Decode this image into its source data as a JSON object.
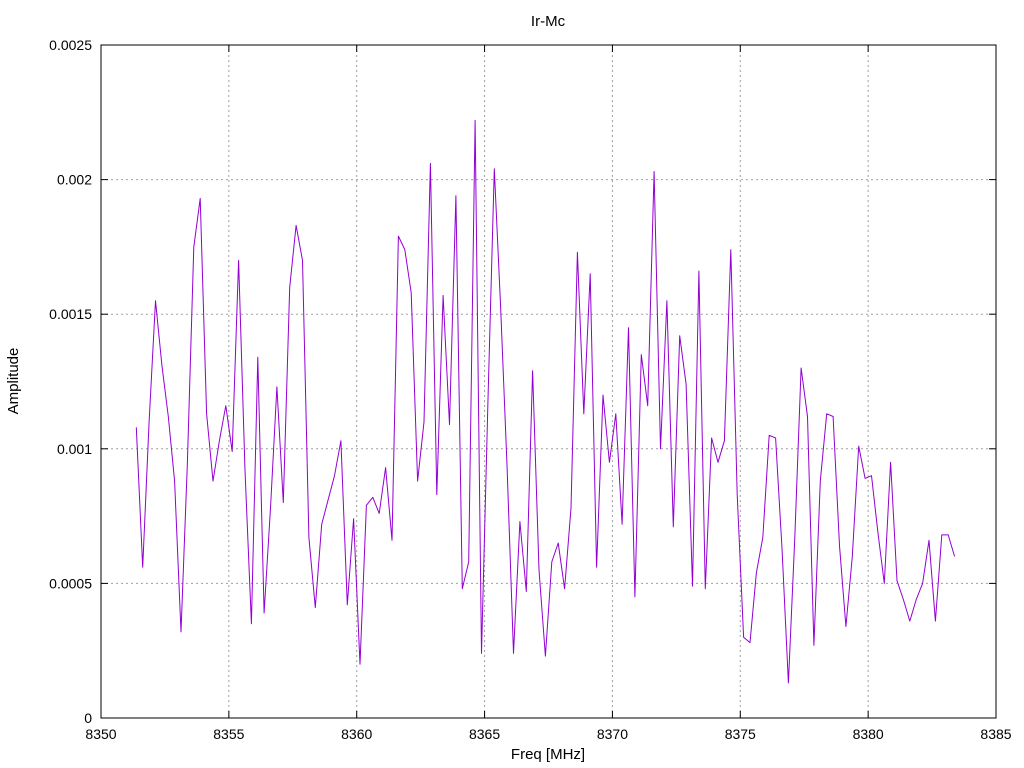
{
  "chart_data": {
    "type": "line",
    "title": "Ir-Mc",
    "xlabel": "Freq [MHz]",
    "ylabel": "Amplitude",
    "xlim": [
      8350,
      8385
    ],
    "ylim": [
      0,
      0.0025
    ],
    "x_ticks": [
      "8350",
      "8355",
      "8360",
      "8365",
      "8370",
      "8375",
      "8380",
      "8385"
    ],
    "y_ticks": [
      "0",
      "0.0005",
      "0.001",
      "0.0015",
      "0.002",
      "0.0025"
    ],
    "grid": true,
    "line_color": "#9400d3",
    "series": [
      {
        "x": [
          8351.38,
          8351.63,
          8351.88,
          8352.13,
          8352.38,
          8352.63,
          8352.88,
          8353.13,
          8353.38,
          8353.63,
          8353.88,
          8354.13,
          8354.38,
          8354.63,
          8354.88,
          8355.13,
          8355.38,
          8355.63,
          8355.88,
          8356.13,
          8356.38,
          8356.63,
          8356.88,
          8357.13,
          8357.38,
          8357.63,
          8357.88,
          8358.13,
          8358.38,
          8358.63,
          8358.88,
          8359.13,
          8359.38,
          8359.63,
          8359.88,
          8360.13,
          8360.38,
          8360.63,
          8360.88,
          8361.13,
          8361.38,
          8361.63,
          8361.88,
          8362.13,
          8362.38,
          8362.63,
          8362.88,
          8363.13,
          8363.38,
          8363.63,
          8363.88,
          8364.13,
          8364.38,
          8364.63,
          8364.88,
          8365.13,
          8365.38,
          8365.63,
          8365.88,
          8366.13,
          8366.38,
          8366.63,
          8366.88,
          8367.13,
          8367.38,
          8367.63,
          8367.88,
          8368.13,
          8368.38,
          8368.63,
          8368.88,
          8369.13,
          8369.38,
          8369.63,
          8369.88,
          8370.13,
          8370.38,
          8370.63,
          8370.88,
          8371.13,
          8371.38,
          8371.63,
          8371.88,
          8372.13,
          8372.38,
          8372.63,
          8372.88,
          8373.13,
          8373.38,
          8373.63,
          8373.88,
          8374.13,
          8374.38,
          8374.63,
          8374.88,
          8375.13,
          8375.38,
          8375.63,
          8375.88,
          8376.13,
          8376.38,
          8376.63,
          8376.88,
          8377.13,
          8377.38,
          8377.63,
          8377.88,
          8378.13,
          8378.38,
          8378.63,
          8378.88,
          8379.13,
          8379.38,
          8379.63,
          8379.88,
          8380.13,
          8380.38,
          8380.63,
          8380.88,
          8381.13,
          8381.38,
          8381.63,
          8381.88,
          8382.13,
          8382.38,
          8382.63,
          8382.88,
          8383.13,
          8383.38
        ],
        "y": [
          0.00108,
          0.00056,
          0.0011,
          0.00155,
          0.00131,
          0.00112,
          0.00088,
          0.00032,
          0.00095,
          0.00175,
          0.00193,
          0.00113,
          0.00088,
          0.00103,
          0.00116,
          0.00099,
          0.0017,
          0.00092,
          0.00035,
          0.00134,
          0.00039,
          0.00078,
          0.00123,
          0.0008,
          0.0016,
          0.00183,
          0.0017,
          0.00067,
          0.00041,
          0.00072,
          0.00081,
          0.0009,
          0.00103,
          0.00042,
          0.00074,
          0.0002,
          0.00079,
          0.00082,
          0.00076,
          0.00093,
          0.00066,
          0.00179,
          0.00174,
          0.00158,
          0.00088,
          0.0011,
          0.00206,
          0.00083,
          0.00157,
          0.00109,
          0.00194,
          0.00048,
          0.00058,
          0.00222,
          0.00024,
          0.00117,
          0.00204,
          0.00152,
          0.00093,
          0.00024,
          0.00073,
          0.00047,
          0.00129,
          0.00055,
          0.00023,
          0.00058,
          0.00065,
          0.00048,
          0.00078,
          0.00173,
          0.00113,
          0.00165,
          0.00056,
          0.0012,
          0.00095,
          0.00113,
          0.00072,
          0.00145,
          0.00045,
          0.00135,
          0.00116,
          0.00203,
          0.001,
          0.00155,
          0.00071,
          0.00142,
          0.00124,
          0.00049,
          0.00166,
          0.00048,
          0.00104,
          0.00095,
          0.00103,
          0.00174,
          0.00083,
          0.0003,
          0.00028,
          0.00054,
          0.00067,
          0.00105,
          0.00104,
          0.00063,
          0.00013,
          0.00067,
          0.0013,
          0.00112,
          0.00027,
          0.00088,
          0.00113,
          0.00112,
          0.00064,
          0.00034,
          0.0006,
          0.00101,
          0.00089,
          0.0009,
          0.00069,
          0.0005,
          0.00095,
          0.00051,
          0.00044,
          0.00036,
          0.00044,
          0.0005,
          0.00066,
          0.00036,
          0.00068,
          0.00068,
          0.0006
        ]
      }
    ]
  }
}
